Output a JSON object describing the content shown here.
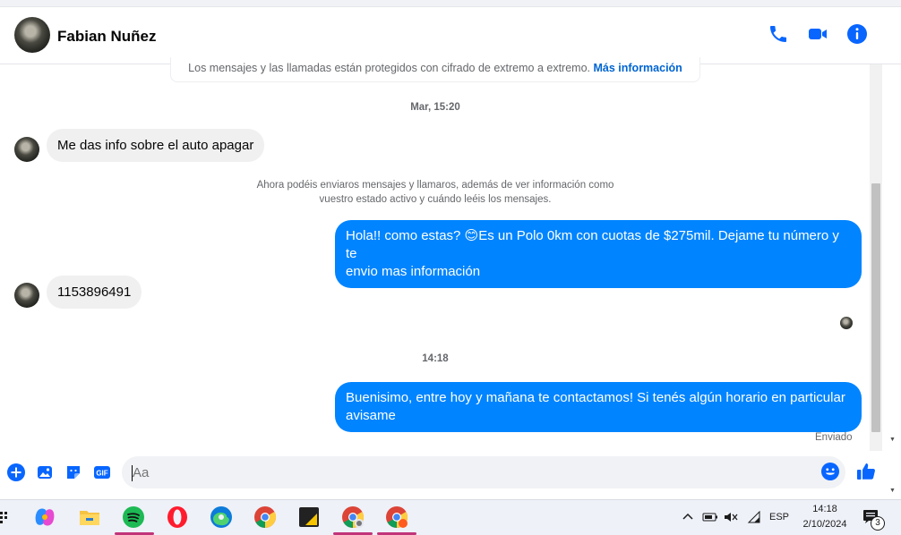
{
  "chat": {
    "contact_name": "Fabian Nuñez",
    "encryption_notice": "Los mensajes y las llamadas están protegidos con cifrado de extremo a extremo.",
    "encryption_link": "Más información",
    "timestamp_1": "Mar, 15:20",
    "timestamp_2": "14:18",
    "system_note_line1": "Ahora podéis enviaros mensajes y llamaros, además de ver información como",
    "system_note_line2": "vuestro estado activo y cuándo leéis los mensajes.",
    "messages": [
      {
        "direction": "in",
        "text": "Me das info sobre el auto apagar"
      },
      {
        "direction": "out",
        "line1": "Hola!! como estas? 😊Es un Polo 0km con cuotas de $275mil. Dejame tu número y te",
        "line2": "envio mas información"
      },
      {
        "direction": "in",
        "text": "1153896491"
      },
      {
        "direction": "out",
        "line1": "Buenisimo, entre hoy y mañana te contactamos! Si tenés algún horario en particular",
        "line2": "avisame"
      }
    ],
    "sent_status": "Enviado"
  },
  "composer": {
    "placeholder": "Aa"
  },
  "taskbar": {
    "language": "ESP",
    "time": "14:18",
    "date": "2/10/2024",
    "notification_count": "3"
  },
  "colors": {
    "accent": "#0084ff",
    "icon_blue": "#0866ff",
    "incoming_bubble": "#f0f0f0"
  }
}
